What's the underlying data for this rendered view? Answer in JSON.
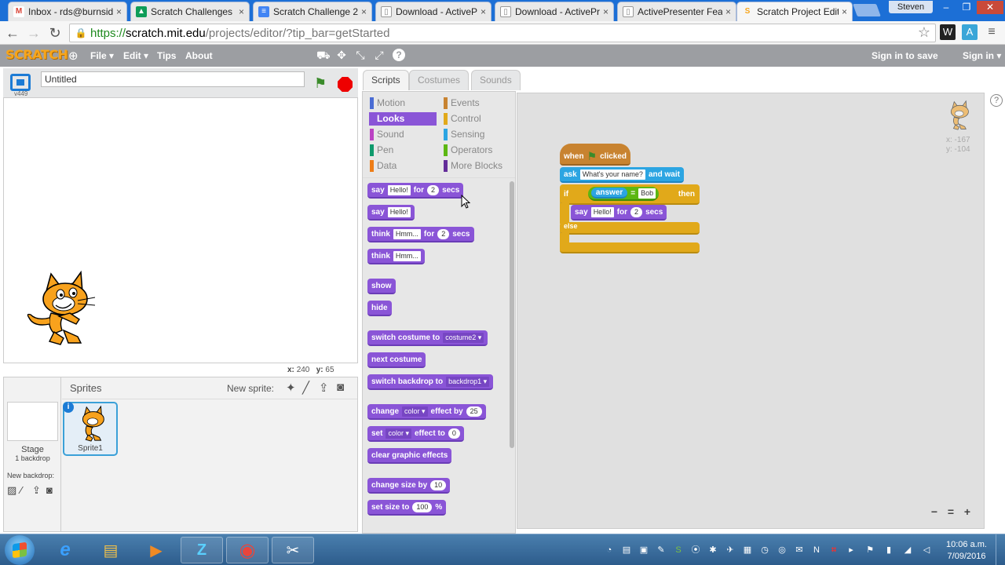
{
  "browser": {
    "tabs": [
      {
        "label": "Inbox - rds@burnsid",
        "icon": "gmail-icon",
        "color": "#db4437"
      },
      {
        "label": "Scratch Challenges",
        "icon": "drive-icon",
        "color": "#0f9d58"
      },
      {
        "label": "Scratch Challenge 2",
        "icon": "docs-icon",
        "color": "#4285f4"
      },
      {
        "label": "Download - ActivePr",
        "icon": "page-icon",
        "color": "#888888"
      },
      {
        "label": "Download - ActivePr",
        "icon": "page-icon",
        "color": "#888888"
      },
      {
        "label": "ActivePresenter Feat",
        "icon": "page-icon",
        "color": "#888888"
      },
      {
        "label": "Scratch Project Edito",
        "icon": "scratch-icon",
        "color": "#f7a51b"
      }
    ],
    "user": "Steven",
    "window_controls": [
      "–",
      "❐",
      "✕"
    ],
    "url": {
      "proto": "https://",
      "host": "scratch.mit.edu",
      "path": "/projects/editor/?tip_bar=getStarted"
    }
  },
  "scratch": {
    "logo": "SCRATCH",
    "menus": [
      "File ▾",
      "Edit ▾",
      "Tips",
      "About"
    ],
    "tools": [
      "⛟",
      "✥",
      "⤡",
      "⤢",
      "?"
    ],
    "sign_in_save": "Sign in to save",
    "sign_in": "Sign in ▾",
    "version": "v449",
    "project_title": "Untitled",
    "stage_coords": {
      "x_label": "x:",
      "x": "240",
      "y_label": "y:",
      "y": "65"
    },
    "sprites_label": "Sprites",
    "new_sprite_label": "New sprite:",
    "stage_label": "Stage",
    "backdrop_count": "1 backdrop",
    "new_backdrop_label": "New backdrop:",
    "sprite_name": "Sprite1",
    "panel_tabs": [
      "Scripts",
      "Costumes",
      "Sounds"
    ],
    "categories": [
      {
        "label": "Motion",
        "color": "#4a6cd4"
      },
      {
        "label": "Events",
        "color": "#c88330"
      },
      {
        "label": "Looks",
        "color": "#8a55d7",
        "selected": true
      },
      {
        "label": "Control",
        "color": "#e1a91a"
      },
      {
        "label": "Sound",
        "color": "#bb42c3"
      },
      {
        "label": "Sensing",
        "color": "#2ca5e2"
      },
      {
        "label": "Pen",
        "color": "#0e9a6c"
      },
      {
        "label": "Operators",
        "color": "#5cb712"
      },
      {
        "label": "Data",
        "color": "#ee7d16"
      },
      {
        "label": "More Blocks",
        "color": "#632d99"
      }
    ],
    "palette_blocks": {
      "say_secs": {
        "a": "say",
        "msg": "Hello!",
        "b": "for",
        "n": "2",
        "c": "secs"
      },
      "say": {
        "a": "say",
        "msg": "Hello!"
      },
      "think_secs": {
        "a": "think",
        "msg": "Hmm...",
        "b": "for",
        "n": "2",
        "c": "secs"
      },
      "think": {
        "a": "think",
        "msg": "Hmm..."
      },
      "show": "show",
      "hide": "hide",
      "switch_costume": {
        "a": "switch costume to",
        "v": "costume2 ▾"
      },
      "next_costume": "next costume",
      "switch_backdrop": {
        "a": "switch backdrop to",
        "v": "backdrop1 ▾"
      },
      "change_effect": {
        "a": "change",
        "v": "color ▾",
        "b": "effect by",
        "n": "25"
      },
      "set_effect": {
        "a": "set",
        "v": "color ▾",
        "b": "effect to",
        "n": "0"
      },
      "clear_effects": "clear graphic effects",
      "change_size": {
        "a": "change size by",
        "n": "10"
      },
      "set_size": {
        "a": "set size to",
        "n": "100",
        "b": "%"
      }
    },
    "script": {
      "hat": {
        "a": "when",
        "b": "clicked"
      },
      "ask": {
        "a": "ask",
        "msg": "What's your name?",
        "b": "and wait"
      },
      "if": {
        "a": "if",
        "reporter": "answer",
        "op": "=",
        "value": "Bob",
        "b": "then"
      },
      "say": {
        "a": "say",
        "msg": "Hello!",
        "b": "for",
        "n": "2",
        "c": "secs"
      },
      "else": "else"
    },
    "scripts_coords": {
      "x": "x: -167",
      "y": "y: -104"
    },
    "zoom": [
      "−",
      "=",
      "+"
    ]
  },
  "taskbar": {
    "apps": [
      {
        "name": "internet-explorer",
        "glyph": "e",
        "color": "#3aa0ff"
      },
      {
        "name": "file-explorer",
        "glyph": "▤",
        "color": "#f0c04a"
      },
      {
        "name": "media-player",
        "glyph": "▶",
        "color": "#f08a24"
      },
      {
        "name": "activepresenter",
        "glyph": "Z",
        "color": "#5ad0ff"
      },
      {
        "name": "chrome",
        "glyph": "◉",
        "color": "#e8453c"
      },
      {
        "name": "snipping-tool",
        "glyph": "✂",
        "color": "#ffffff"
      }
    ],
    "tray": [
      "◔",
      "▤",
      "▣",
      "✎",
      "S",
      "⦿",
      "✱",
      "✈",
      "▦",
      "◷",
      "◎",
      "✉",
      "N",
      "⌗",
      "▸",
      "⚑",
      "▮",
      "◢",
      "◁"
    ],
    "time": "10:06 a.m.",
    "date": "7/09/2016"
  }
}
